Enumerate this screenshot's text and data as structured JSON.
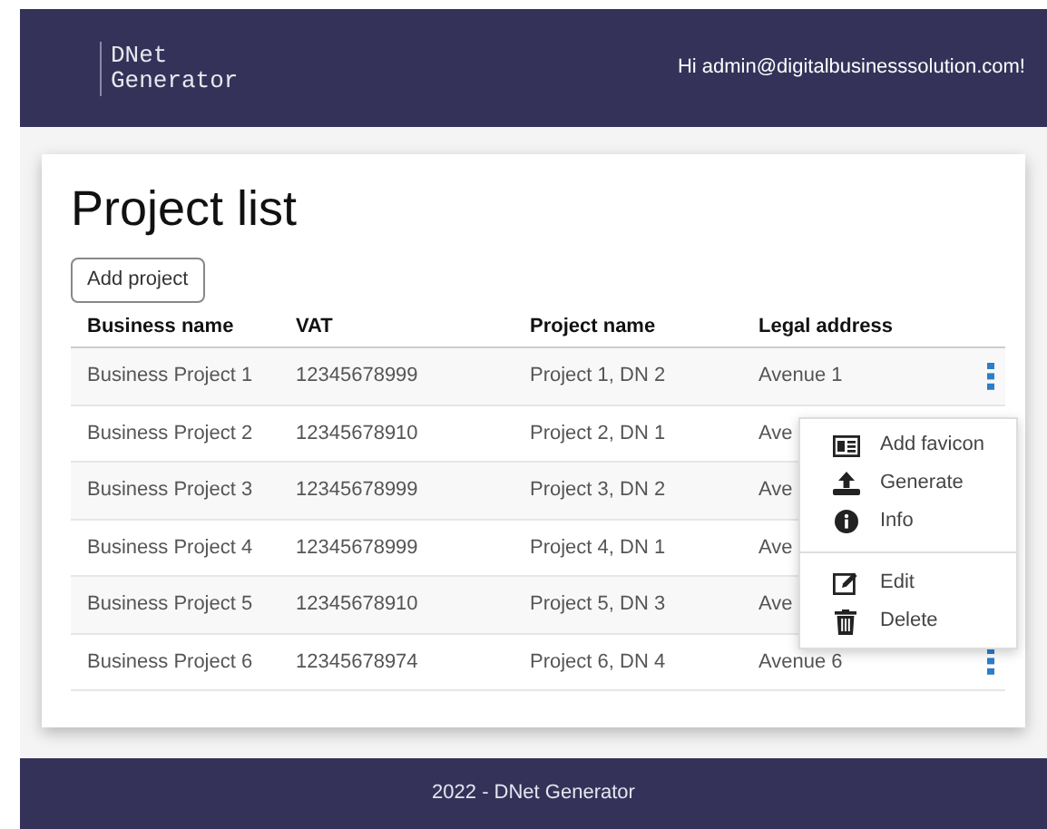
{
  "header": {
    "logo": [
      "DNet",
      "Generator"
    ],
    "greeting": "Hi admin@digitalbusinesssolution.com!"
  },
  "page_title": "Project list",
  "add_button": "Add project",
  "table": {
    "columns": [
      "Business name",
      "VAT",
      "Project name",
      "Legal address"
    ],
    "rows": [
      {
        "cells": [
          "Business Project 1",
          "12345678999",
          "Project 1, DN 2",
          "Avenue 1"
        ],
        "menu_button": true
      },
      {
        "cells": [
          "Business Project 2",
          "12345678910",
          "Project 2, DN 1",
          "Ave"
        ],
        "menu_button": false
      },
      {
        "cells": [
          "Business Project 3",
          "12345678999",
          "Project 3, DN 2",
          "Ave"
        ],
        "menu_button": false
      },
      {
        "cells": [
          "Business Project 4",
          "12345678999",
          "Project 4, DN 1",
          "Ave"
        ],
        "menu_button": false
      },
      {
        "cells": [
          "Business Project 5",
          "12345678910",
          "Project 5, DN 3",
          "Ave"
        ],
        "menu_button": false
      },
      {
        "cells": [
          "Business Project 6",
          "12345678974",
          "Project 6, DN 4",
          "Avenue 6"
        ],
        "menu_button": true
      }
    ]
  },
  "row_menu": {
    "groups": [
      [
        {
          "label": "Add favicon"
        },
        {
          "label": "Generate"
        },
        {
          "label": "Info"
        }
      ],
      [
        {
          "label": "Edit"
        },
        {
          "label": "Delete"
        }
      ]
    ]
  },
  "footer": "2022 - DNet Generator"
}
